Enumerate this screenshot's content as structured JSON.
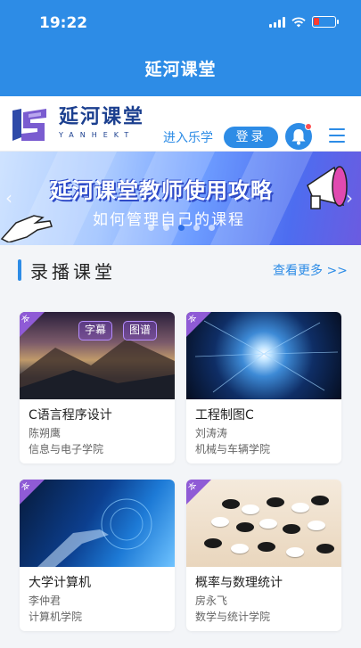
{
  "status_bar": {
    "time": "19:22"
  },
  "nav": {
    "title": "延河课堂"
  },
  "header": {
    "logo_cn": "延河课堂",
    "logo_en": "YANHEKT",
    "enter_label": "进入乐学",
    "login_label": "登录"
  },
  "banner": {
    "title": "延河课堂教师使用攻略",
    "subtitle": "如何管理自己的课程",
    "slides": 5,
    "active_slide": 3
  },
  "section": {
    "title": "录播课堂",
    "more": "查看更多 >>"
  },
  "courses": [
    {
      "title": "C语言程序设计",
      "teacher": "陈朔鹰",
      "school": "信息与电子学院",
      "tags": [
        "字幕",
        "图谱"
      ],
      "ribbon": "本"
    },
    {
      "title": "工程制图C",
      "teacher": "刘涛涛",
      "school": "机械与车辆学院",
      "ribbon": "本"
    },
    {
      "title": "大学计算机",
      "teacher": "李仲君",
      "school": "计算机学院",
      "ribbon": "本"
    },
    {
      "title": "概率与数理统计",
      "teacher": "房永飞",
      "school": "数学与统计学院",
      "ribbon": "本"
    }
  ],
  "colors": {
    "primary": "#2d8ce6",
    "logo": "#1b3f8f",
    "ribbon": "#8f5bd6"
  }
}
